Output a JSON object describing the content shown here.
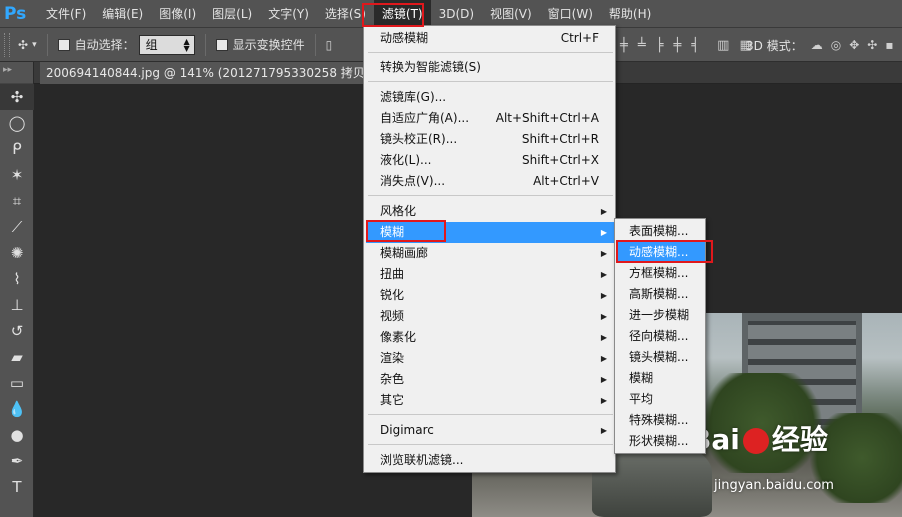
{
  "app": {
    "logo": "Ps"
  },
  "menubar": {
    "items": [
      "文件(F)",
      "编辑(E)",
      "图像(I)",
      "图层(L)",
      "文字(Y)",
      "选择(S)",
      "滤镜(T)",
      "3D(D)",
      "视图(V)",
      "窗口(W)",
      "帮助(H)"
    ],
    "active_index": 6
  },
  "options_bar": {
    "auto_select_label": "自动选择：",
    "auto_select_value": "组",
    "show_transform_label": "显示变换控件",
    "mode_3d_label": "3D 模式："
  },
  "document": {
    "tab_title": "200694140844.jpg @ 141% (201271795330258 拷贝, RGB/"
  },
  "filter_menu": {
    "items": [
      {
        "label": "动感模糊",
        "shortcut": "Ctrl+F"
      },
      {
        "label": "转换为智能滤镜(S)"
      },
      {
        "label": "滤镜库(G)..."
      },
      {
        "label": "自适应广角(A)...",
        "shortcut": "Alt+Shift+Ctrl+A"
      },
      {
        "label": "镜头校正(R)...",
        "shortcut": "Shift+Ctrl+R"
      },
      {
        "label": "液化(L)...",
        "shortcut": "Shift+Ctrl+X"
      },
      {
        "label": "消失点(V)...",
        "shortcut": "Alt+Ctrl+V"
      },
      {
        "label": "风格化",
        "submenu": true
      },
      {
        "label": "模糊",
        "submenu": true
      },
      {
        "label": "模糊画廊",
        "submenu": true
      },
      {
        "label": "扭曲",
        "submenu": true
      },
      {
        "label": "锐化",
        "submenu": true
      },
      {
        "label": "视频",
        "submenu": true
      },
      {
        "label": "像素化",
        "submenu": true
      },
      {
        "label": "渲染",
        "submenu": true
      },
      {
        "label": "杂色",
        "submenu": true
      },
      {
        "label": "其它",
        "submenu": true
      },
      {
        "label": "Digimarc",
        "submenu": true
      },
      {
        "label": "浏览联机滤镜..."
      }
    ],
    "highlighted": "模糊"
  },
  "blur_submenu": {
    "items": [
      "表面模糊...",
      "动感模糊...",
      "方框模糊...",
      "高斯模糊...",
      "进一步模糊",
      "径向模糊...",
      "镜头模糊...",
      "模糊",
      "平均",
      "特殊模糊...",
      "形状模糊..."
    ],
    "highlighted": "动感模糊..."
  },
  "watermark": {
    "brand": "Bai",
    "brand2": "经验",
    "url": "jingyan.baidu.com"
  },
  "colors": {
    "highlight": "#3399ff",
    "callout": "#e0181c",
    "menu_bg": "#f0f0f0",
    "chrome": "#535353"
  },
  "icons": {
    "tools": [
      "move-tool-icon",
      "marquee-tool-icon",
      "lasso-tool-icon",
      "magic-wand-icon",
      "crop-tool-icon",
      "eyedropper-icon",
      "healing-brush-icon",
      "brush-tool-icon",
      "clone-stamp-icon",
      "history-brush-icon",
      "eraser-icon",
      "gradient-tool-icon",
      "blur-tool-icon",
      "dodge-tool-icon",
      "pen-tool-icon",
      "type-tool-icon"
    ]
  }
}
